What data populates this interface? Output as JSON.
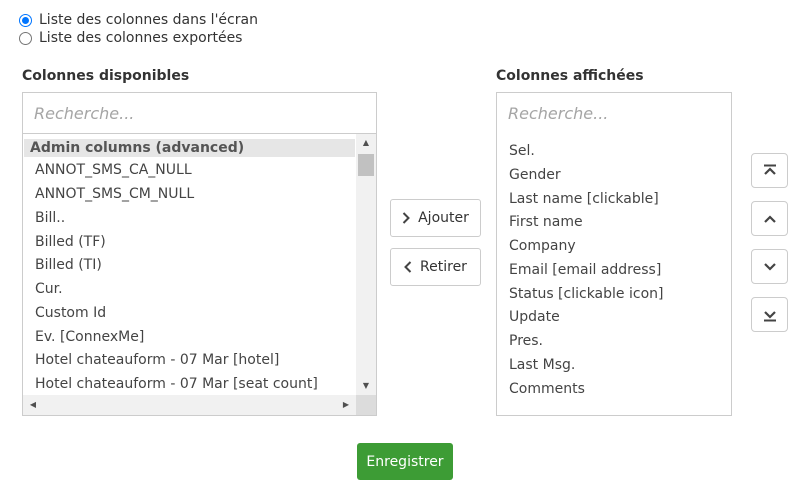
{
  "mode_options": [
    {
      "label": "Liste des colonnes dans l'écran",
      "checked": true
    },
    {
      "label": "Liste des colonnes exportées",
      "checked": false
    }
  ],
  "available": {
    "title": "Colonnes disponibles",
    "search_placeholder": "Recherche...",
    "group_header": "Admin columns (advanced)",
    "items": [
      "ANNOT_SMS_CA_NULL",
      "ANNOT_SMS_CM_NULL",
      "Bill..",
      "Billed (TF)",
      "Billed (TI)",
      "Cur.",
      "Custom Id",
      "Ev. [ConnexMe]",
      "Hotel chateauform - 07 Mar [hotel]",
      "Hotel chateauform - 07 Mar [seat count]"
    ]
  },
  "displayed": {
    "title": "Colonnes affichées",
    "search_placeholder": "Recherche...",
    "items": [
      "Sel.",
      "Gender",
      "Last name [clickable]",
      "First name",
      "Company",
      "Email [email address]",
      "Status [clickable icon]",
      "Update",
      "Pres.",
      "Last Msg.",
      "Comments"
    ]
  },
  "actions": {
    "add_label": "Ajouter",
    "remove_label": "Retirer",
    "save_label": "Enregistrer"
  },
  "colors": {
    "save_bg": "#3d9c35",
    "radio_accent": "#0075ff"
  }
}
